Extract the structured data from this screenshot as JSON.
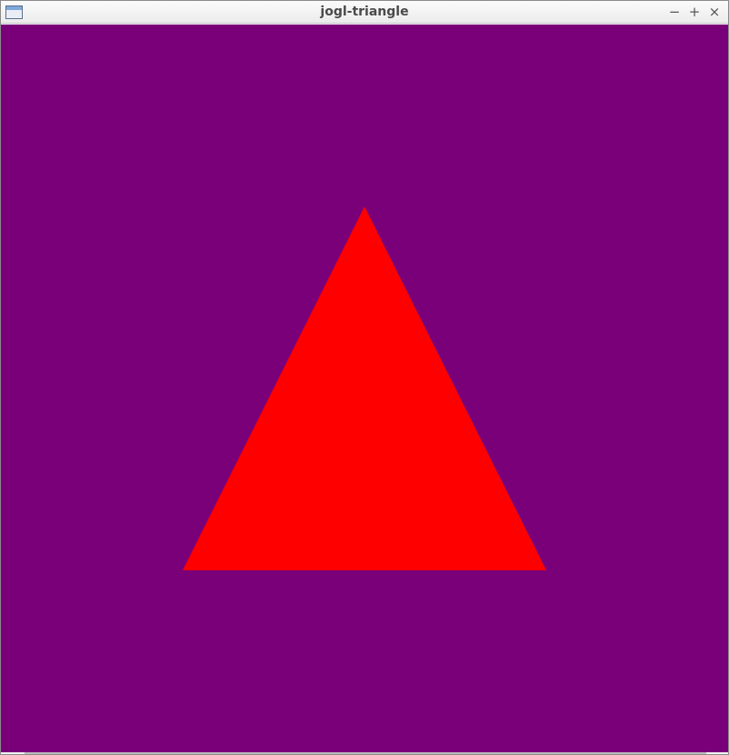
{
  "window": {
    "title": "jogl-triangle",
    "icons": {
      "app": "window-icon",
      "minimize": "minimize-icon",
      "maximize": "maximize-icon",
      "close": "close-icon"
    },
    "control_glyphs": {
      "minimize": "−",
      "maximize": "+",
      "close": "×"
    }
  },
  "scene": {
    "clear_color": "#7a007a",
    "triangle_color": "#ff0000",
    "triangle_vertices_ndc": [
      [
        0.0,
        0.5
      ],
      [
        -0.5,
        -0.5
      ],
      [
        0.5,
        -0.5
      ]
    ]
  }
}
